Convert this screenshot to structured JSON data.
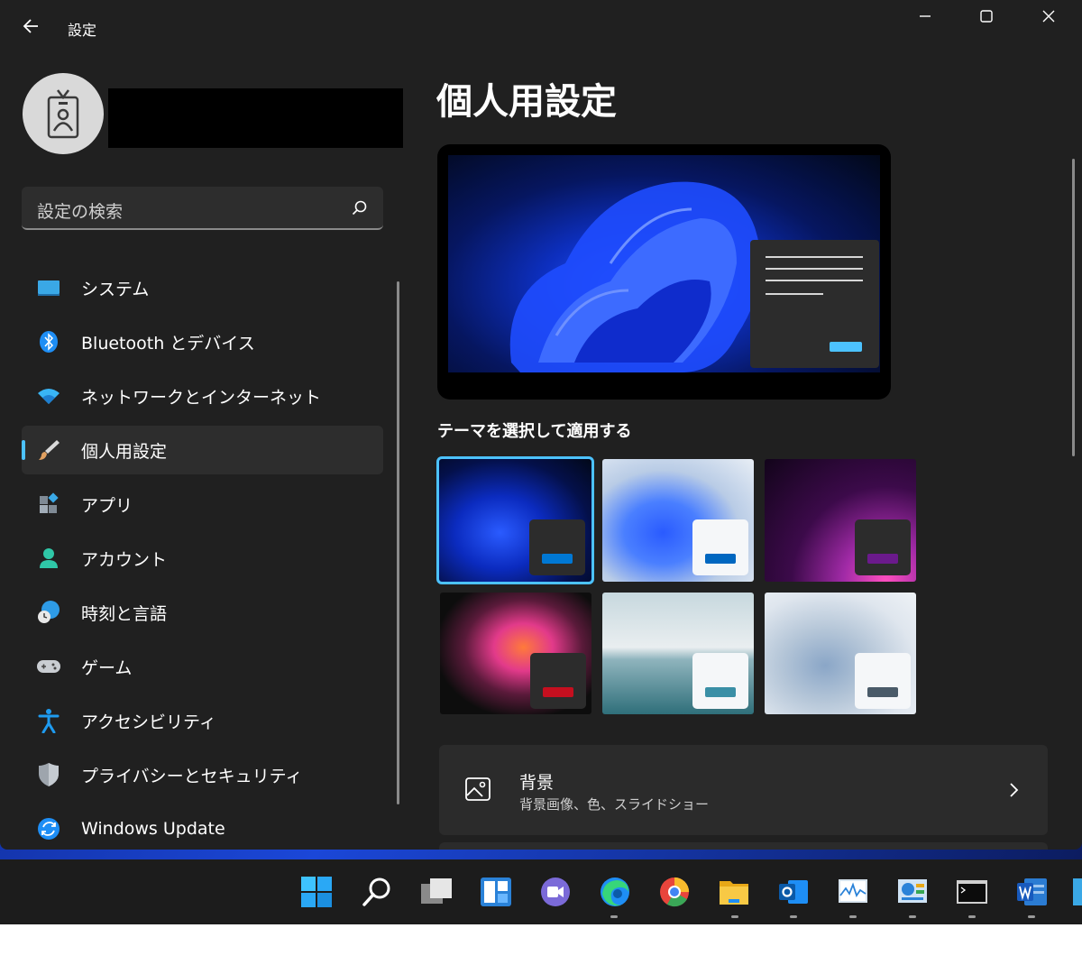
{
  "window": {
    "title": "設定"
  },
  "search": {
    "placeholder": "設定の検索"
  },
  "nav": {
    "items": [
      {
        "label": "システム",
        "icon": "system-icon"
      },
      {
        "label": "Bluetooth とデバイス",
        "icon": "bluetooth-icon"
      },
      {
        "label": "ネットワークとインターネット",
        "icon": "wifi-icon"
      },
      {
        "label": "個人用設定",
        "icon": "brush-icon",
        "active": true
      },
      {
        "label": "アプリ",
        "icon": "apps-icon"
      },
      {
        "label": "アカウント",
        "icon": "account-icon"
      },
      {
        "label": "時刻と言語",
        "icon": "time-language-icon"
      },
      {
        "label": "ゲーム",
        "icon": "gamepad-icon"
      },
      {
        "label": "アクセシビリティ",
        "icon": "accessibility-icon"
      },
      {
        "label": "プライバシーとセキュリティ",
        "icon": "shield-icon"
      },
      {
        "label": "Windows Update",
        "icon": "update-icon"
      }
    ]
  },
  "main": {
    "title": "個人用設定",
    "theme_heading": "テーマを選択して適用する",
    "themes": [
      {
        "name": "theme-windows-dark",
        "selected": true,
        "accent": "#0078d4"
      },
      {
        "name": "theme-windows-light",
        "selected": false,
        "accent": "#0067c0"
      },
      {
        "name": "theme-glow",
        "selected": false,
        "accent": "#6b1a8c"
      },
      {
        "name": "theme-captured-motion",
        "selected": false,
        "accent": "#c50f1f"
      },
      {
        "name": "theme-sunrise",
        "selected": false,
        "accent": "#3a8fa6"
      },
      {
        "name": "theme-flow",
        "selected": false,
        "accent": "#4a5b69"
      }
    ],
    "background": {
      "title": "背景",
      "subtitle": "背景画像、色、スライドショー"
    }
  },
  "colors": {
    "accent": "#4cc2ff",
    "window_bg": "#202020",
    "card_bg": "#2b2b2b"
  },
  "taskbar": {
    "items": [
      "start-icon",
      "search-icon",
      "task-view-icon",
      "widgets-icon",
      "teams-chat-icon",
      "edge-icon",
      "chrome-icon",
      "file-explorer-icon",
      "outlook-icon",
      "resource-monitor-icon",
      "control-panel-icon",
      "terminal-icon",
      "word-icon",
      "app-icon"
    ]
  }
}
